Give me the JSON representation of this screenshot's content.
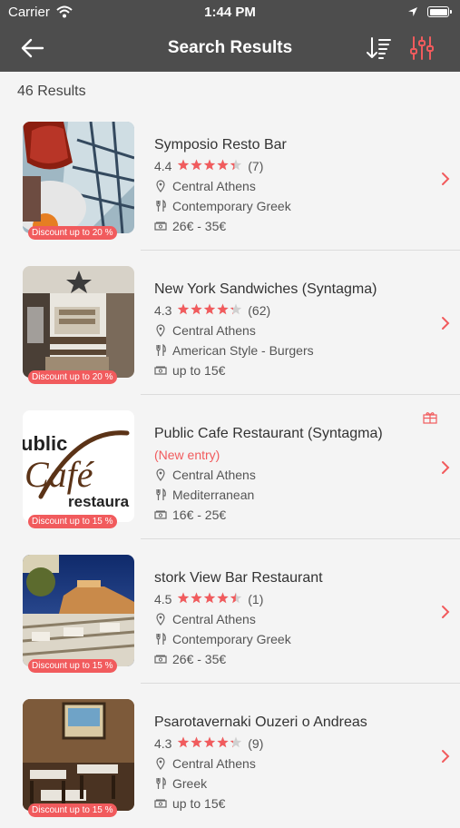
{
  "status_bar": {
    "carrier": "Carrier",
    "time": "1:44 PM"
  },
  "header": {
    "title": "Search Results"
  },
  "results_count": "46 Results",
  "colors": {
    "accent": "#f15b5d",
    "header_bg": "#4d4d4d",
    "background": "#f4f4f4"
  },
  "restaurants": [
    {
      "name": "Symposio Resto Bar",
      "rating": "4.4",
      "stars": 4.4,
      "reviews": "(7)",
      "area": "Central Athens",
      "cuisine": "Contemporary Greek",
      "price": "26€ - 35€",
      "discount": "Discount up to 20 %"
    },
    {
      "name": "New York Sandwiches (Syntagma)",
      "rating": "4.3",
      "stars": 4.3,
      "reviews": "(62)",
      "area": "Central Athens",
      "cuisine": "American Style - Burgers",
      "price": "up to 15€",
      "discount": "Discount up to 20 %"
    },
    {
      "name": "Public Cafe Restaurant (Syntagma)",
      "new_entry": "(New entry)",
      "area": "Central Athens",
      "cuisine": "Mediterranean",
      "price": "16€ - 25€",
      "discount": "Discount up to 15 %",
      "logo_text": [
        "ublic",
        "Café",
        "restaura"
      ]
    },
    {
      "name": "stork View Bar Restaurant",
      "rating": "4.5",
      "stars": 4.5,
      "reviews": "(1)",
      "area": "Central Athens",
      "cuisine": "Contemporary Greek",
      "price": "26€ - 35€",
      "discount": "Discount up to 15 %"
    },
    {
      "name": "Psarotavernaki Ouzeri o Andreas",
      "rating": "4.3",
      "stars": 4.3,
      "reviews": "(9)",
      "area": "Central Athens",
      "cuisine": "Greek",
      "price": "up to 15€",
      "discount": "Discount up to 15 %"
    }
  ]
}
